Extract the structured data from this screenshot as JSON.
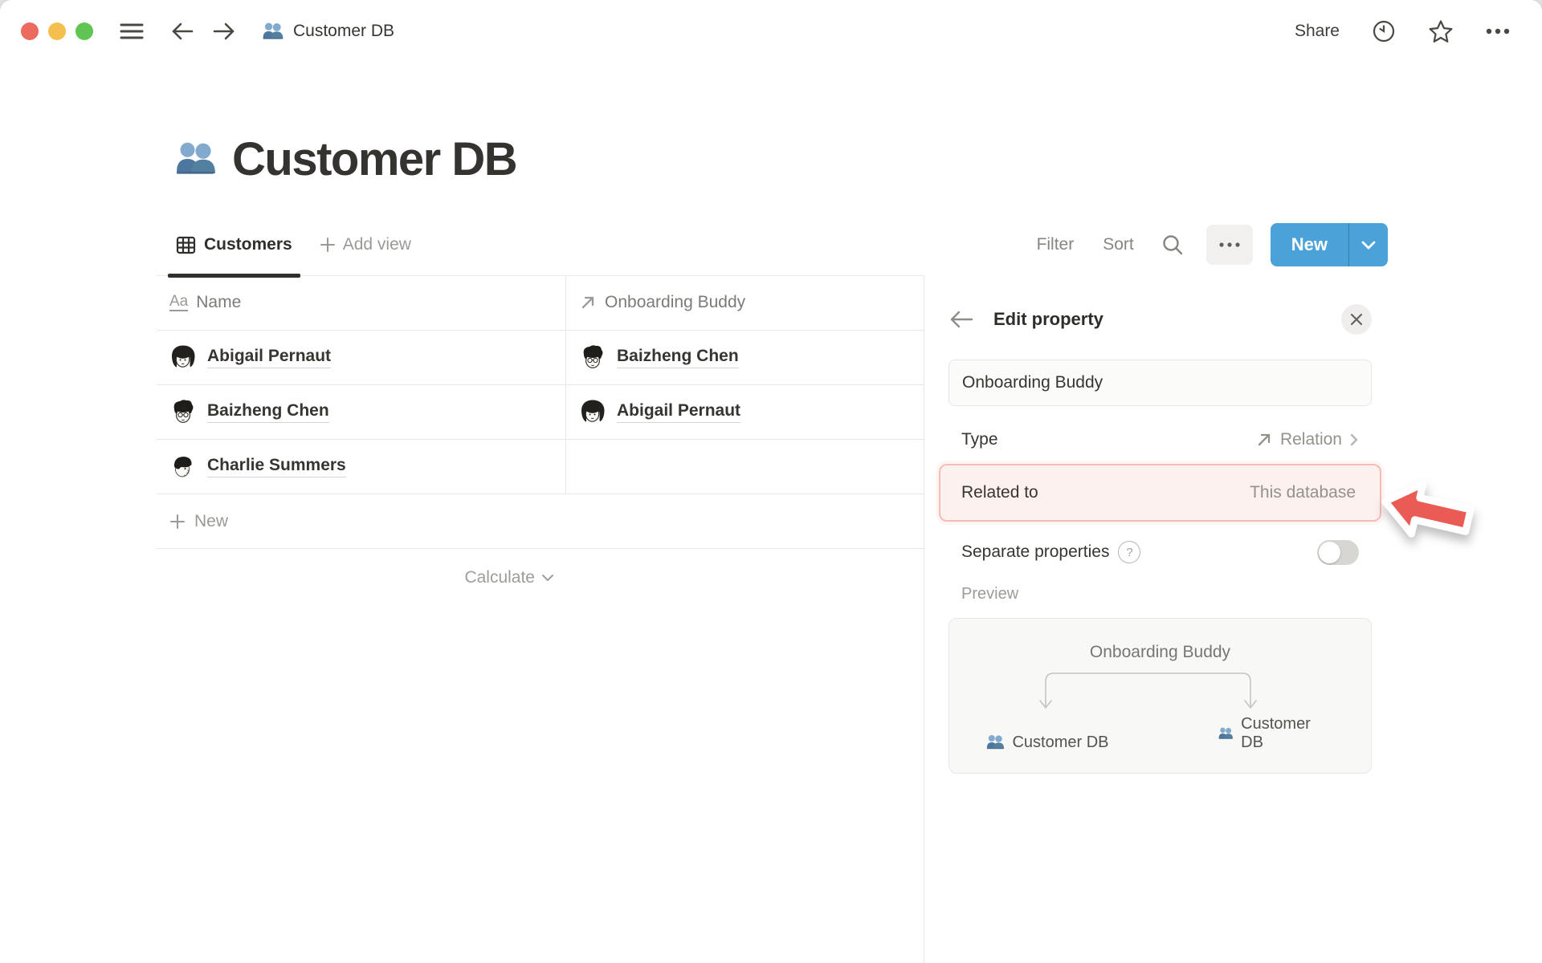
{
  "titlebar": {
    "breadcrumb": "Customer DB",
    "share": "Share"
  },
  "page": {
    "title": "Customer DB"
  },
  "toolbar": {
    "tab_customers": "Customers",
    "add_view": "Add view",
    "filter": "Filter",
    "sort": "Sort",
    "new": "New"
  },
  "table": {
    "header": {
      "name_type_glyph": "Aa",
      "name": "Name",
      "buddy": "Onboarding Buddy"
    },
    "rows": [
      {
        "name": "Abigail Pernaut",
        "buddy": "Baizheng Chen"
      },
      {
        "name": "Baizheng Chen",
        "buddy": "Abigail Pernaut"
      },
      {
        "name": "Charlie Summers",
        "buddy": ""
      }
    ],
    "new_row": "New",
    "calculate": "Calculate"
  },
  "panel": {
    "title": "Edit property",
    "name_value": "Onboarding Buddy",
    "type_label": "Type",
    "type_value": "Relation",
    "related_label": "Related to",
    "related_value": "This database",
    "separate_label": "Separate properties",
    "help_glyph": "?",
    "preview_label": "Preview",
    "preview_property": "Onboarding Buddy",
    "preview_left_db": "Customer DB",
    "preview_right_db": "Customer DB"
  },
  "colors": {
    "accent_blue": "#4ba2d9",
    "highlight_bg": "#fdf1ef",
    "highlight_border": "#f3bcb6",
    "arrow_red": "#ea5b55",
    "traffic_red": "#ec6a5e",
    "traffic_yellow": "#f5bf4f",
    "traffic_green": "#61c554",
    "db_icon_blue": "#5c87b0"
  }
}
